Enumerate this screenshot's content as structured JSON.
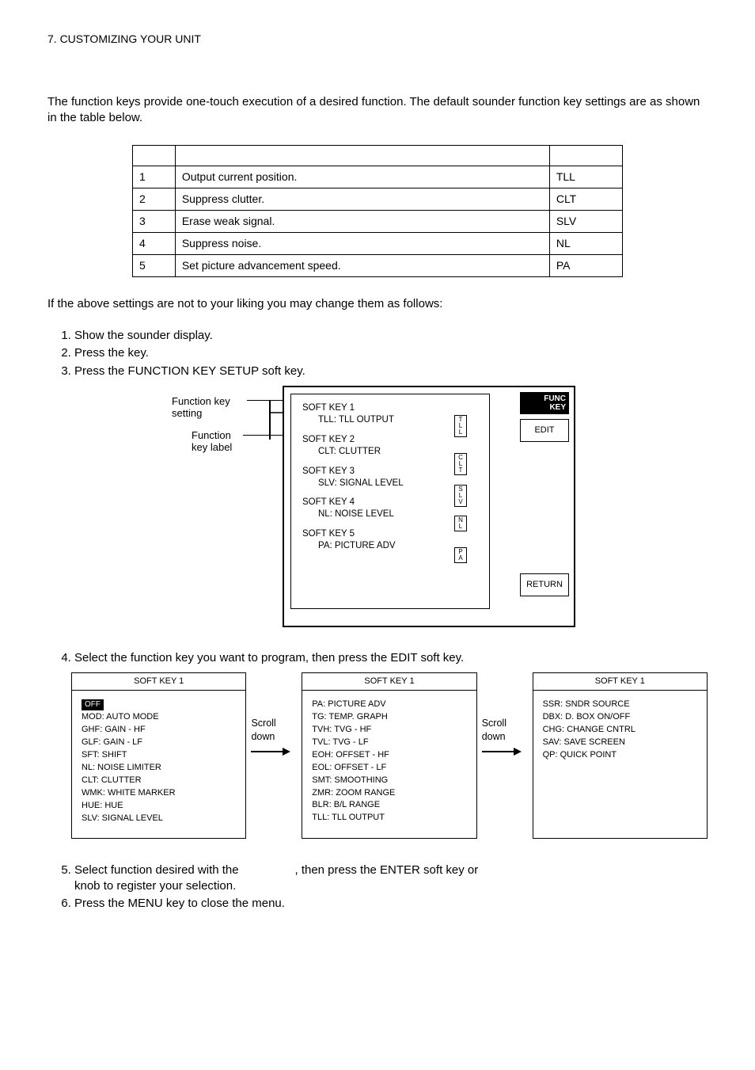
{
  "header": "7. CUSTOMIZING YOUR UNIT",
  "intro": "The function keys provide one-touch execution of a desired function. The default sounder function key settings are as shown in the table below.",
  "table": {
    "rows": [
      {
        "k": "1",
        "f": "Output current position.",
        "l": "TLL"
      },
      {
        "k": "2",
        "f": "Suppress clutter.",
        "l": "CLT"
      },
      {
        "k": "3",
        "f": "Erase weak signal.",
        "l": "SLV"
      },
      {
        "k": "4",
        "f": "Suppress noise.",
        "l": "NL"
      },
      {
        "k": "5",
        "f": "Set picture advancement speed.",
        "l": "PA"
      }
    ]
  },
  "between": "If the above settings are not to your liking you may change them as follows:",
  "steps123": [
    "Show the sounder display.",
    "Press the             key.",
    "Press the FUNCTION KEY SETUP soft key."
  ],
  "labels": {
    "funckey": "Function key",
    "setting": "setting",
    "funclabel1": "Function",
    "funclabel2": "key label"
  },
  "screen": {
    "sk1a": "SOFT KEY 1",
    "sk1b": "TLL: TLL OUTPUT",
    "sk2a": "SOFT KEY 2",
    "sk2b": "CLT: CLUTTER",
    "sk3a": "SOFT KEY 3",
    "sk3b": "SLV: SIGNAL LEVEL",
    "sk4a": "SOFT KEY 4",
    "sk4b": "NL: NOISE LEVEL",
    "sk5a": "SOFT KEY 5",
    "sk5b": "PA: PICTURE ADV",
    "mini": {
      "tll": [
        "T",
        "L",
        "L"
      ],
      "clt": [
        "C",
        "L",
        "T"
      ],
      "slv": [
        "S",
        "L",
        "V"
      ],
      "nl": [
        "N",
        "L"
      ],
      "pa": [
        "P",
        "A"
      ]
    },
    "side_top1": "FUNC",
    "side_top2": "KEY",
    "edit": "EDIT",
    "return": "RETURN"
  },
  "step4": "Select the function key you want to program, then press the EDIT soft key.",
  "panels": {
    "title": "SOFT KEY 1",
    "p1": [
      "MOD: AUTO MODE",
      "GHF: GAIN - HF",
      "GLF: GAIN - LF",
      "SFT: SHIFT",
      "NL: NOISE LIMITER",
      "CLT: CLUTTER",
      "WMK: WHITE MARKER",
      "HUE: HUE",
      "SLV: SIGNAL LEVEL"
    ],
    "off": "OFF",
    "p2": [
      "PA: PICTURE ADV",
      "TG: TEMP. GRAPH",
      "TVH: TVG - HF",
      "TVL: TVG - LF",
      "EOH: OFFSET - HF",
      "EOL: OFFSET - LF",
      "SMT: SMOOTHING",
      "ZMR: ZOOM RANGE",
      "BLR: B/L RANGE",
      "TLL: TLL OUTPUT"
    ],
    "p3": [
      "SSR: SNDR SOURCE",
      "DBX: D. BOX ON/OFF",
      "CHG: CHANGE CNTRL",
      "SAV: SAVE SCREEN",
      "QP: QUICK POINT"
    ],
    "scroll": "Scroll",
    "down": "down"
  },
  "step5a": "Select function desired with the ",
  "step5b": ", then press the ENTER soft key or",
  "step5c": "knob to register your selection.",
  "step6": "Press the MENU key to close the menu."
}
